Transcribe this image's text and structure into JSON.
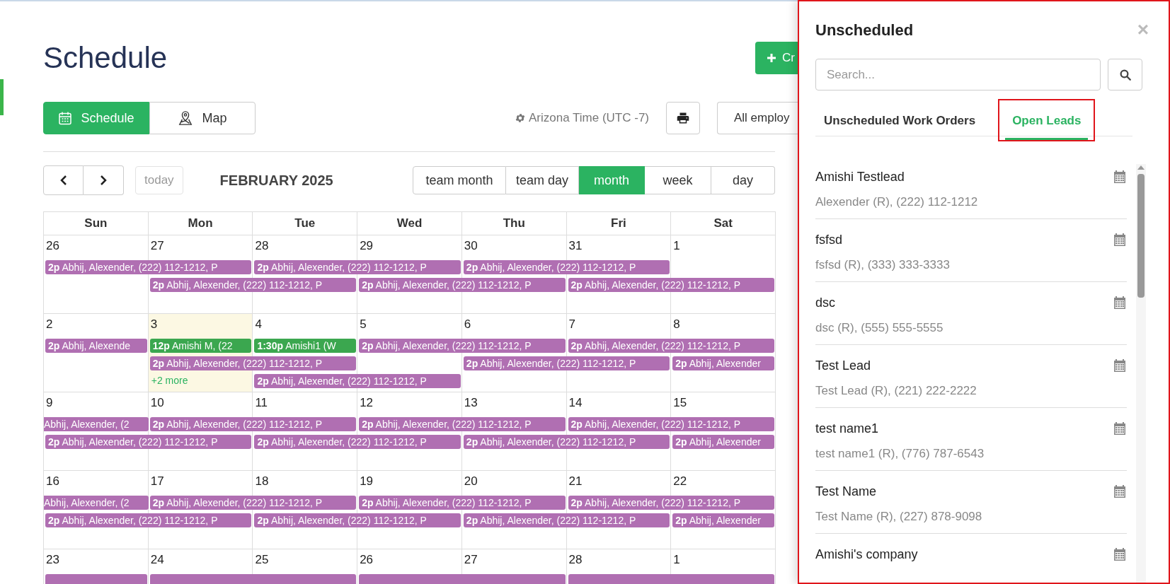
{
  "page": {
    "title": "Schedule",
    "create_button": "Cr"
  },
  "view_toggle": [
    {
      "kind": "calendar",
      "label": "Schedule",
      "selected": true
    },
    {
      "kind": "map",
      "label": "Map",
      "selected": false
    }
  ],
  "timezone": "Arizona Time (UTC -7)",
  "employee_filter": "All employ",
  "calendar": {
    "title": "FEBRUARY 2025",
    "today_button": "today",
    "views": [
      {
        "label": "team month",
        "selected": false
      },
      {
        "label": "team day",
        "selected": false
      },
      {
        "label": "month",
        "selected": true
      },
      {
        "label": "week",
        "selected": false
      },
      {
        "label": "day",
        "selected": false
      }
    ],
    "weekdays": [
      "Sun",
      "Mon",
      "Tue",
      "Wed",
      "Thu",
      "Fri",
      "Sat"
    ],
    "weeks": [
      {
        "days": [
          {
            "date": "26",
            "today": false
          },
          {
            "date": "27",
            "today": false
          },
          {
            "date": "28",
            "today": false
          },
          {
            "date": "29",
            "today": false
          },
          {
            "date": "30",
            "today": false
          },
          {
            "date": "31",
            "today": false
          },
          {
            "date": "1",
            "today": false
          }
        ],
        "lanes": [
          [
            {
              "kind": "event",
              "time": "2p",
              "text": "Abhij, Alexender, (222) 112-1212, P",
              "color": "#b06fb2"
            },
            {
              "kind": "continued"
            },
            {
              "kind": "event",
              "time": "2p",
              "text": "Abhij, Alexender, (222) 112-1212, P",
              "color": "#b06fb2"
            },
            {
              "kind": "continued"
            },
            {
              "kind": "event",
              "time": "2p",
              "text": "Abhij, Alexender, (222) 112-1212, P",
              "color": "#b06fb2"
            },
            {
              "kind": "continued"
            },
            {
              "kind": "empty"
            }
          ],
          [
            {
              "kind": "empty"
            },
            {
              "kind": "event",
              "time": "2p",
              "text": "Abhij, Alexender, (222) 112-1212, P",
              "color": "#b06fb2"
            },
            {
              "kind": "continued"
            },
            {
              "kind": "event",
              "time": "2p",
              "text": "Abhij, Alexender, (222) 112-1212, P",
              "color": "#b06fb2"
            },
            {
              "kind": "continued"
            },
            {
              "kind": "event",
              "time": "2p",
              "text": "Abhij, Alexender, (222) 112-1212, P",
              "color": "#b06fb2"
            },
            {
              "kind": "continued"
            }
          ]
        ]
      },
      {
        "days": [
          {
            "date": "2",
            "today": false
          },
          {
            "date": "3",
            "today": true
          },
          {
            "date": "4",
            "today": false
          },
          {
            "date": "5",
            "today": false
          },
          {
            "date": "6",
            "today": false
          },
          {
            "date": "7",
            "today": false
          },
          {
            "date": "8",
            "today": false
          }
        ],
        "lanes": [
          [
            {
              "kind": "event",
              "time": "2p",
              "text": "Abhij, Alexende",
              "color": "#b06fb2"
            },
            {
              "kind": "event",
              "time": "12p",
              "text": "Amishi M, (22",
              "color": "#3ba74f"
            },
            {
              "kind": "event",
              "time": "1:30p",
              "text": "Amishi1 (W",
              "color": "#3ba74f"
            },
            {
              "kind": "event",
              "time": "2p",
              "text": "Abhij, Alexender, (222) 112-1212, P",
              "color": "#b06fb2"
            },
            {
              "kind": "continued"
            },
            {
              "kind": "event",
              "time": "2p",
              "text": "Abhij, Alexender, (222) 112-1212, P",
              "color": "#b06fb2"
            },
            {
              "kind": "continued"
            }
          ],
          [
            {
              "kind": "empty"
            },
            {
              "kind": "event",
              "time": "2p",
              "text": "Abhij, Alexender, (222) 112-1212, P",
              "color": "#b06fb2"
            },
            {
              "kind": "continued"
            },
            {
              "kind": "empty"
            },
            {
              "kind": "event",
              "time": "2p",
              "text": "Abhij, Alexender, (222) 112-1212, P",
              "color": "#b06fb2"
            },
            {
              "kind": "continued"
            },
            {
              "kind": "event",
              "time": "2p",
              "text": "Abhij, Alexender",
              "color": "#b06fb2"
            }
          ],
          [
            {
              "kind": "empty"
            },
            {
              "kind": "more",
              "text": "+2 more"
            },
            {
              "kind": "event",
              "time": "2p",
              "text": "Abhij, Alexender, (222) 112-1212, P",
              "color": "#b06fb2"
            },
            {
              "kind": "continued"
            },
            {
              "kind": "empty"
            },
            {
              "kind": "empty"
            },
            {
              "kind": "empty"
            }
          ]
        ]
      },
      {
        "days": [
          {
            "date": "9",
            "today": false
          },
          {
            "date": "10",
            "today": false
          },
          {
            "date": "11",
            "today": false
          },
          {
            "date": "12",
            "today": false
          },
          {
            "date": "13",
            "today": false
          },
          {
            "date": "14",
            "today": false
          },
          {
            "date": "15",
            "today": false
          }
        ],
        "lanes": [
          [
            {
              "kind": "event",
              "text": "Abhij, Alexender, (2",
              "color": "#b06fb2"
            },
            {
              "kind": "event",
              "time": "2p",
              "text": "Abhij, Alexender, (222) 112-1212, P",
              "color": "#b06fb2"
            },
            {
              "kind": "continued"
            },
            {
              "kind": "event",
              "time": "2p",
              "text": "Abhij, Alexender, (222) 112-1212, P",
              "color": "#b06fb2"
            },
            {
              "kind": "continued"
            },
            {
              "kind": "event",
              "time": "2p",
              "text": "Abhij, Alexender, (222) 112-1212, P",
              "color": "#b06fb2"
            },
            {
              "kind": "continued"
            }
          ],
          [
            {
              "kind": "event",
              "time": "2p",
              "text": "Abhij, Alexender, (222) 112-1212, P",
              "color": "#b06fb2"
            },
            {
              "kind": "continued"
            },
            {
              "kind": "event",
              "time": "2p",
              "text": "Abhij, Alexender, (222) 112-1212, P",
              "color": "#b06fb2"
            },
            {
              "kind": "continued"
            },
            {
              "kind": "event",
              "time": "2p",
              "text": "Abhij, Alexender, (222) 112-1212, P",
              "color": "#b06fb2"
            },
            {
              "kind": "continued"
            },
            {
              "kind": "event",
              "time": "2p",
              "text": "Abhij, Alexender",
              "color": "#b06fb2"
            }
          ]
        ]
      },
      {
        "days": [
          {
            "date": "16",
            "today": false
          },
          {
            "date": "17",
            "today": false
          },
          {
            "date": "18",
            "today": false
          },
          {
            "date": "19",
            "today": false
          },
          {
            "date": "20",
            "today": false
          },
          {
            "date": "21",
            "today": false
          },
          {
            "date": "22",
            "today": false
          }
        ],
        "lanes": [
          [
            {
              "kind": "event",
              "text": "Abhij, Alexender, (2",
              "color": "#b06fb2"
            },
            {
              "kind": "event",
              "time": "2p",
              "text": "Abhij, Alexender, (222) 112-1212, P",
              "color": "#b06fb2"
            },
            {
              "kind": "continued"
            },
            {
              "kind": "event",
              "time": "2p",
              "text": "Abhij, Alexender, (222) 112-1212, P",
              "color": "#b06fb2"
            },
            {
              "kind": "continued"
            },
            {
              "kind": "event",
              "time": "2p",
              "text": "Abhij, Alexender, (222) 112-1212, P",
              "color": "#b06fb2"
            },
            {
              "kind": "continued"
            }
          ],
          [
            {
              "kind": "event",
              "time": "2p",
              "text": "Abhij, Alexender, (222) 112-1212, P",
              "color": "#b06fb2"
            },
            {
              "kind": "continued"
            },
            {
              "kind": "event",
              "time": "2p",
              "text": "Abhij, Alexender, (222) 112-1212, P",
              "color": "#b06fb2"
            },
            {
              "kind": "continued"
            },
            {
              "kind": "event",
              "time": "2p",
              "text": "Abhij, Alexender, (222) 112-1212, P",
              "color": "#b06fb2"
            },
            {
              "kind": "continued"
            },
            {
              "kind": "event",
              "time": "2p",
              "text": "Abhij, Alexender",
              "color": "#b06fb2"
            }
          ]
        ]
      },
      {
        "days": [
          {
            "date": "23",
            "today": false
          },
          {
            "date": "24",
            "today": false
          },
          {
            "date": "25",
            "today": false
          },
          {
            "date": "26",
            "today": false
          },
          {
            "date": "27",
            "today": false
          },
          {
            "date": "28",
            "today": false
          },
          {
            "date": "1",
            "today": false
          }
        ],
        "lanes": [
          [
            {
              "kind": "event",
              "color": "#b06fb2"
            },
            {
              "kind": "event",
              "color": "#b06fb2"
            },
            {
              "kind": "continued"
            },
            {
              "kind": "event",
              "color": "#b06fb2"
            },
            {
              "kind": "continued"
            },
            {
              "kind": "event",
              "color": "#b06fb2"
            },
            {
              "kind": "continued"
            }
          ]
        ]
      }
    ]
  },
  "unscheduled_panel": {
    "title": "Unscheduled",
    "close": "×",
    "annotated": true,
    "search": {
      "placeholder": "Search..."
    },
    "tabs": [
      {
        "label": "Unscheduled Work Orders",
        "selected": false,
        "annotated": false
      },
      {
        "label": "Open Leads",
        "selected": true,
        "annotated": true
      }
    ],
    "leads": [
      {
        "name": "Amishi Testlead",
        "detail": "Alexender (R), (222) 112-1212"
      },
      {
        "name": "fsfsd",
        "detail": "fsfsd (R), (333) 333-3333"
      },
      {
        "name": "dsc",
        "detail": "dsc (R), (555) 555-5555"
      },
      {
        "name": "Test Lead",
        "detail": "Test Lead (R), (221) 222-2222"
      },
      {
        "name": "test name1",
        "detail": "test name1 (R), (776) 787-6543"
      },
      {
        "name": "Test Name",
        "detail": "Test Name (R), (227) 878-9098"
      },
      {
        "name": "Amishi's company"
      }
    ]
  }
}
